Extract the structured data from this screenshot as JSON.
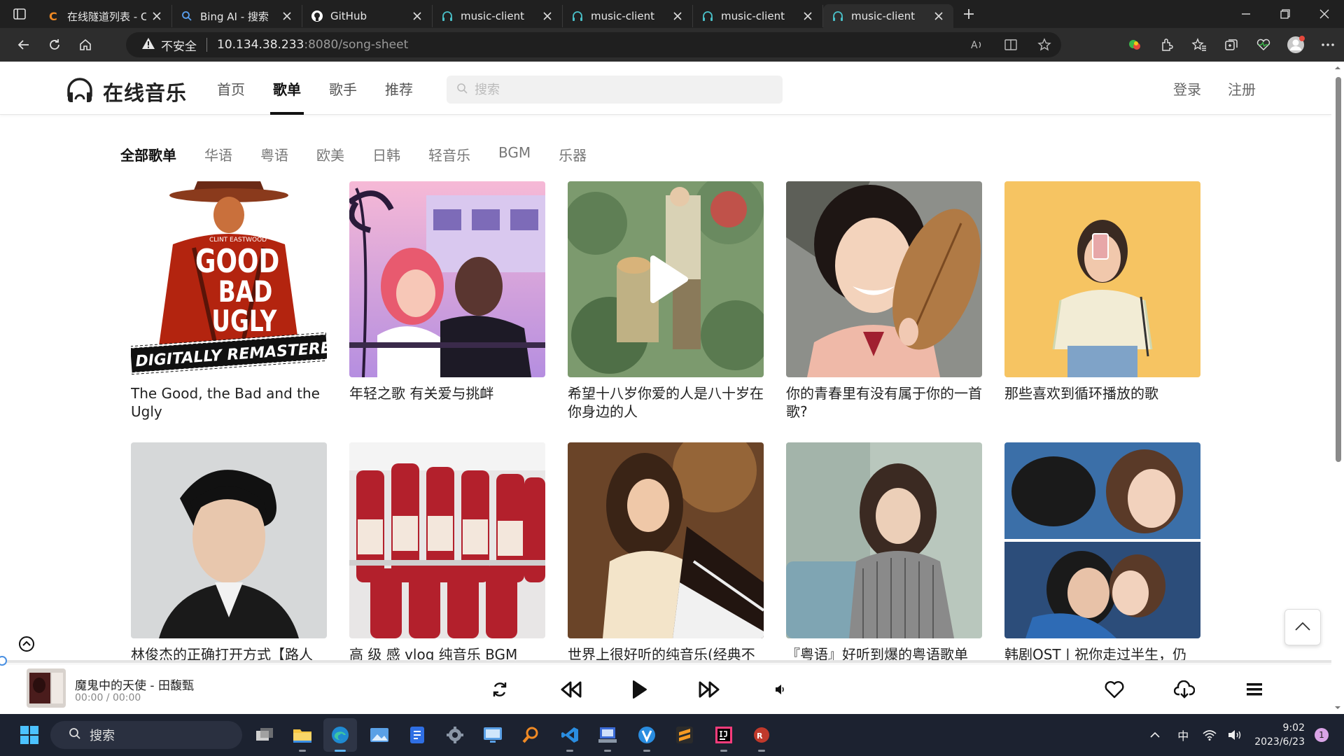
{
  "browser": {
    "tabs": [
      {
        "title": "在线隧道列表 - Cpolar",
        "icon": "cpolar-icon"
      },
      {
        "title": "Bing AI - 搜索",
        "icon": "bing-search-icon"
      },
      {
        "title": "GitHub",
        "icon": "github-icon"
      },
      {
        "title": "music-client",
        "icon": "headphones-icon"
      },
      {
        "title": "music-client",
        "icon": "headphones-icon"
      },
      {
        "title": "music-client",
        "icon": "headphones-icon"
      },
      {
        "title": "music-client",
        "icon": "headphones-icon",
        "active": true
      }
    ],
    "security_label": "不安全",
    "url_host": "10.134.38.233",
    "url_path": ":8080/song-sheet"
  },
  "site": {
    "brand": "在线音乐",
    "nav": [
      {
        "label": "首页"
      },
      {
        "label": "歌单",
        "active": true
      },
      {
        "label": "歌手"
      },
      {
        "label": "推荐"
      }
    ],
    "search_placeholder": "搜索",
    "login": "登录",
    "register": "注册"
  },
  "categories": [
    {
      "label": "全部歌单",
      "active": true
    },
    {
      "label": "华语"
    },
    {
      "label": "粤语"
    },
    {
      "label": "欧美"
    },
    {
      "label": "日韩"
    },
    {
      "label": "轻音乐"
    },
    {
      "label": "BGM"
    },
    {
      "label": "乐器"
    }
  ],
  "playlists": [
    {
      "title": "The Good, the Bad and the Ugly"
    },
    {
      "title": "年轻之歌 有关爱与挑衅"
    },
    {
      "title": "希望十八岁你爱的人是八十岁在你身边的人"
    },
    {
      "title": "你的青春里有没有属于你的一首歌?"
    },
    {
      "title": "那些喜欢到循环播放的歌"
    },
    {
      "title": "林俊杰的正确打开方式【路人"
    },
    {
      "title": "高 级 感 vlog 纯音乐 BGM"
    },
    {
      "title": "世界上很好听的纯音乐(经典不"
    },
    {
      "title": "『粤语』好听到爆的粤语歌单"
    },
    {
      "title": "韩剧OST | 祝你走过半生，仍有"
    }
  ],
  "cover_art_text": {
    "poster_top": "CLINT EASTWOOD",
    "poster_good": "GOOD",
    "poster_bad": "BAD",
    "poster_ugly": "UGLY",
    "poster_banner": "DIGITALLY REMASTERED"
  },
  "player": {
    "song": "魔鬼中的天使 - 田馥甄",
    "time": "00:00 / 00:00",
    "progress": 0
  },
  "taskbar": {
    "search_label": "搜索",
    "ime": "中",
    "time": "9:02",
    "date": "2023/6/23",
    "notifications": "1"
  }
}
